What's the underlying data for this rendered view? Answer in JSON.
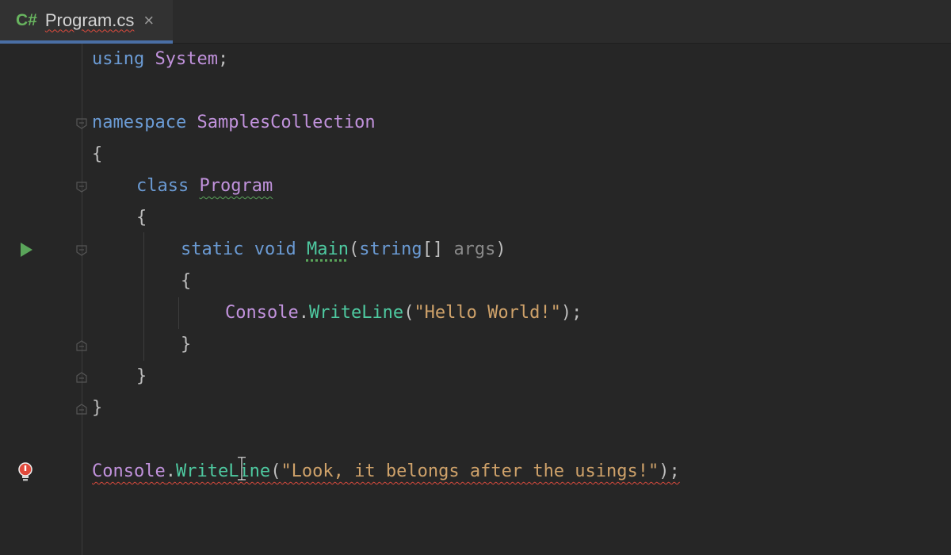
{
  "tab": {
    "lang": "C#",
    "filename": "Program.cs",
    "close_glyph": "×"
  },
  "code": {
    "l1": {
      "kw": "using",
      "ns": "System",
      "end": ";"
    },
    "l3": {
      "kw": "namespace",
      "name": "SamplesCollection"
    },
    "l4": "{",
    "l5": {
      "kw": "class",
      "name": "Program"
    },
    "l6": "{",
    "l7": {
      "kw1": "static",
      "kw2": "void",
      "method": "Main",
      "open": "(",
      "ptype": "string",
      "brackets": "[]",
      "pname": "args",
      "close": ")"
    },
    "l8": "{",
    "l9": {
      "cls": "Console",
      "dot": ".",
      "method": "WriteLine",
      "open": "(",
      "str": "\"Hello World!\"",
      "close": ");"
    },
    "l10": "}",
    "l11": "}",
    "l12": "}",
    "l14": {
      "cls": "Console",
      "dot": ".",
      "method": "WriteLine",
      "open": "(",
      "str": "\"Look, it belongs after the usings!\"",
      "close": ");"
    }
  },
  "icons": {
    "run": "run-triangle-icon",
    "bulb": "quick-fix-bulb-icon",
    "cursor": "text-cursor-icon",
    "fold": "fold-marker-icon"
  },
  "colors": {
    "background": "#262626",
    "keyword": "#6b9bd4",
    "type": "#c192dc",
    "method": "#4ec9a0",
    "string": "#cfa26a",
    "error": "#d94a3d",
    "run": "#5aa55a"
  }
}
